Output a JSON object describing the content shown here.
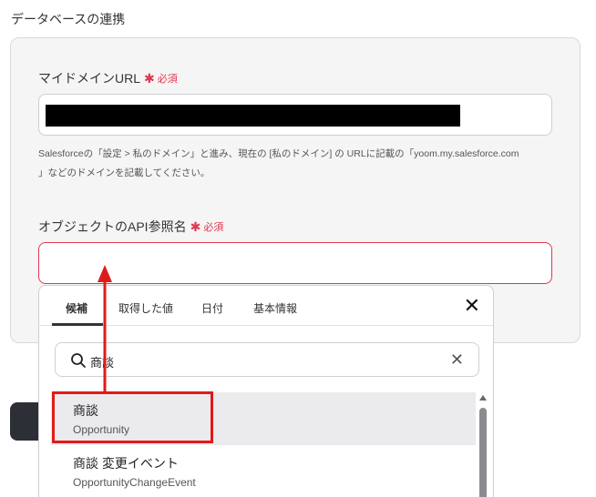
{
  "section": {
    "title": "データベースの連携"
  },
  "domain_field": {
    "label": "マイドメインURL",
    "required_star": "✱",
    "required_text": "必須",
    "help_line1": "Salesforceの「設定 > 私のドメイン」と進み、現在の [私のドメイン] の URLに記載の「yoom.my.salesforce.com",
    "help_line2": "」などのドメインを記載してください。"
  },
  "api_field": {
    "label": "オブジェクトのAPI参照名",
    "required_star": "✱",
    "required_text": "必須"
  },
  "dropdown": {
    "tabs": [
      {
        "label": "候補"
      },
      {
        "label": "取得した値"
      },
      {
        "label": "日付"
      },
      {
        "label": "基本情報"
      }
    ],
    "close_glyph": "✕",
    "search": {
      "value": "商談",
      "clear_glyph": "✕"
    },
    "options": [
      {
        "title": "商談",
        "subtitle": "Opportunity"
      },
      {
        "title": "商談 変更イベント",
        "subtitle": "OpportunityChangeEvent"
      }
    ]
  },
  "colors": {
    "required": "#e0364f",
    "annotation": "#e01b1b",
    "card_bg": "#f5f5f6"
  },
  "icons": {
    "search": "search-icon",
    "close": "close-icon",
    "clear": "clear-icon",
    "scroll_up": "chevron-up-icon"
  }
}
